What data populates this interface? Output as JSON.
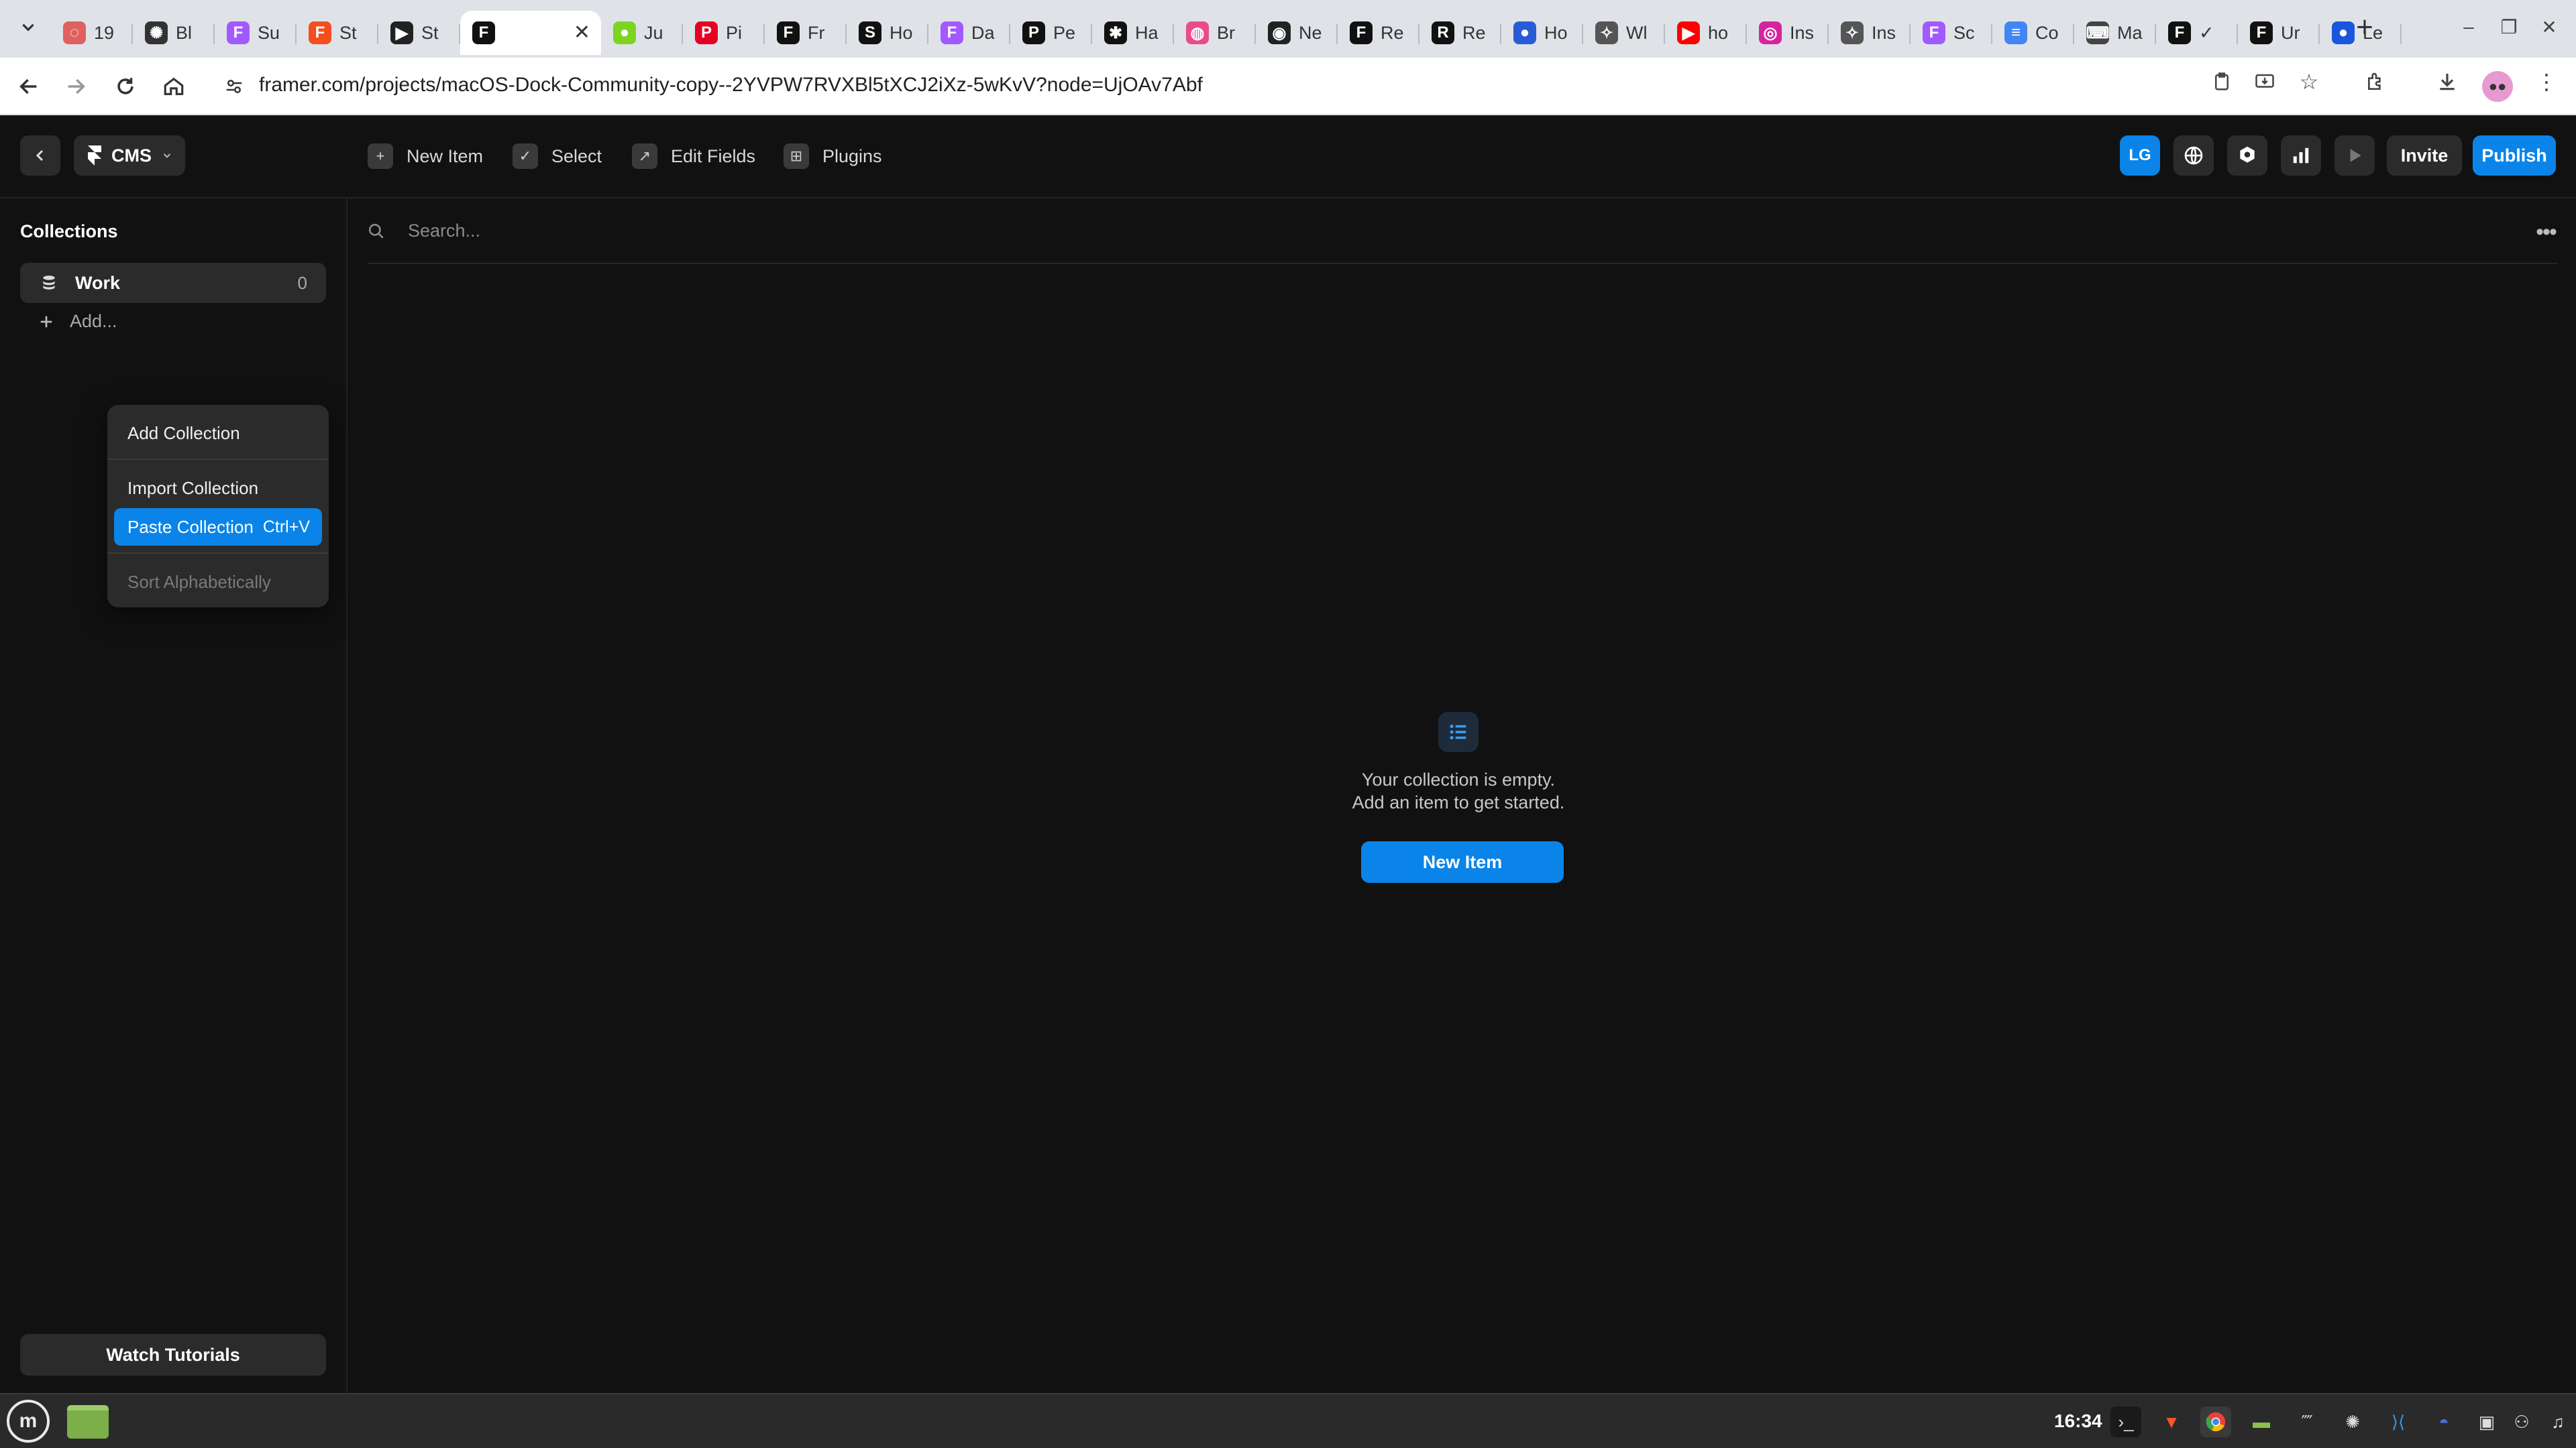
{
  "browser": {
    "tabs": [
      {
        "title": "19",
        "favicon": "loading-ring-icon",
        "color": "#e06060",
        "glyph": "◌"
      },
      {
        "title": "Bl",
        "favicon": "openai-icon",
        "color": "#333333",
        "glyph": "✺"
      },
      {
        "title": "Su",
        "favicon": "figma-icon",
        "color": "#a259ff",
        "glyph": "F"
      },
      {
        "title": "St",
        "favicon": "figma-icon",
        "color": "#f24e1e",
        "glyph": "F"
      },
      {
        "title": "St",
        "favicon": "play-icon",
        "color": "#222222",
        "glyph": "▶"
      },
      {
        "title": "",
        "favicon": "framer-icon",
        "color": "#111111",
        "glyph": "F",
        "active": true
      },
      {
        "title": "Ju",
        "favicon": "green-dot-icon",
        "color": "#7ed321",
        "glyph": "●"
      },
      {
        "title": "Pi",
        "favicon": "pinterest-icon",
        "color": "#e60023",
        "glyph": "P"
      },
      {
        "title": "Fr",
        "favicon": "framer-icon",
        "color": "#111111",
        "glyph": "F"
      },
      {
        "title": "Ho",
        "favicon": "s-icon",
        "color": "#111111",
        "glyph": "S"
      },
      {
        "title": "Da",
        "favicon": "figma-icon",
        "color": "#a259ff",
        "glyph": "F"
      },
      {
        "title": "Pe",
        "favicon": "p-icon",
        "color": "#111111",
        "glyph": "P"
      },
      {
        "title": "Ha",
        "favicon": "star-icon",
        "color": "#111111",
        "glyph": "✱"
      },
      {
        "title": "Br",
        "favicon": "dribbble-icon",
        "color": "#ea4c89",
        "glyph": "◍"
      },
      {
        "title": "Ne",
        "favicon": "github-icon",
        "color": "#222222",
        "glyph": "◉"
      },
      {
        "title": "Re",
        "favicon": "framer-icon",
        "color": "#111111",
        "glyph": "F"
      },
      {
        "title": "Re",
        "favicon": "r-icon",
        "color": "#111111",
        "glyph": "R"
      },
      {
        "title": "Ho",
        "favicon": "blue-dot-icon",
        "color": "#2a5bd7",
        "glyph": "●"
      },
      {
        "title": "Wl",
        "favicon": "sparkle-icon",
        "color": "#555555",
        "glyph": "✧"
      },
      {
        "title": "ho",
        "favicon": "youtube-icon",
        "color": "#ff0000",
        "glyph": "▶"
      },
      {
        "title": "Ins",
        "favicon": "instagram-icon",
        "color": "#d6249f",
        "glyph": "◎"
      },
      {
        "title": "Ins",
        "favicon": "sparkle-icon",
        "color": "#555555",
        "glyph": "✧"
      },
      {
        "title": "Sc",
        "favicon": "figma-icon",
        "color": "#a259ff",
        "glyph": "F"
      },
      {
        "title": "Co",
        "favicon": "docs-icon",
        "color": "#4285f4",
        "glyph": "≡"
      },
      {
        "title": "Ma",
        "favicon": "keyboard-icon",
        "color": "#444444",
        "glyph": "⌨"
      },
      {
        "title": "✓",
        "favicon": "framer-icon",
        "color": "#111111",
        "glyph": "F"
      },
      {
        "title": "Ur",
        "favicon": "framer-icon",
        "color": "#111111",
        "glyph": "F"
      },
      {
        "title": "Le",
        "favicon": "blue-dot-icon",
        "color": "#1a56db",
        "glyph": "●"
      }
    ],
    "url": "framer.com/projects/macOS-Dock-Community-copy--2YVPW7RVXBl5tXCJ2iXz-5wKvV?node=UjOAv7Abf"
  },
  "topbar": {
    "cms_label": "CMS",
    "new_item": "New Item",
    "select": "Select",
    "edit_fields": "Edit Fields",
    "plugins": "Plugins",
    "avatar_initials": "LG",
    "invite": "Invite",
    "publish": "Publish"
  },
  "sidebar": {
    "title": "Collections",
    "collections": [
      {
        "name": "Work",
        "count": "0"
      }
    ],
    "add_label": "Add...",
    "watch_tutorials": "Watch Tutorials"
  },
  "context_menu": {
    "add_collection": "Add Collection",
    "import_collection": "Import Collection",
    "paste_collection": "Paste Collection",
    "paste_shortcut": "Ctrl+V",
    "sort_alphabetically": "Sort Alphabetically"
  },
  "main": {
    "search_placeholder": "Search...",
    "empty_line1": "Your collection is empty.",
    "empty_line2": "Add an item to get started.",
    "empty_button": "New Item"
  },
  "taskbar": {
    "clock": "16:34"
  },
  "colors": {
    "accent": "#0a84e8",
    "background": "#111111",
    "surface": "#2b2b2b"
  }
}
